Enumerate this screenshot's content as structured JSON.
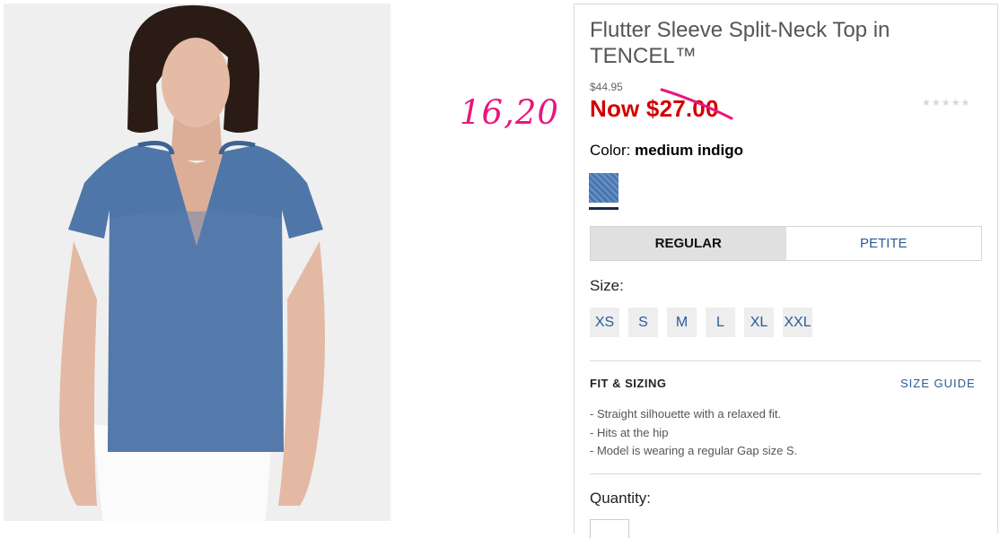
{
  "product": {
    "title": "Flutter Sleeve Split-Neck Top in TENCEL™",
    "original_price": "$44.95",
    "sale_price": "Now $27.00",
    "rating_stars": "★★★★★",
    "color_label": "Color:",
    "color_value": "medium indigo"
  },
  "annotation": "16,20",
  "fit_toggle": {
    "regular_label": "REGULAR",
    "petite_label": "PETITE",
    "selected": "REGULAR"
  },
  "sizes": {
    "label": "Size:",
    "options": [
      "XS",
      "S",
      "M",
      "L",
      "XL",
      "XXL"
    ]
  },
  "fit_sizing": {
    "heading": "FIT & SIZING",
    "guide_link": "SIZE GUIDE",
    "bullets": [
      "- Straight silhouette with a relaxed fit.",
      "- Hits at the hip",
      "- Model is wearing a regular Gap size S."
    ]
  },
  "quantity": {
    "label": "Quantity:"
  },
  "colors": {
    "sale_red": "#d10000",
    "link_blue": "#2d5a98",
    "annotation_pink": "#e8177d",
    "swatch_indigo": "#4f7bb5"
  }
}
